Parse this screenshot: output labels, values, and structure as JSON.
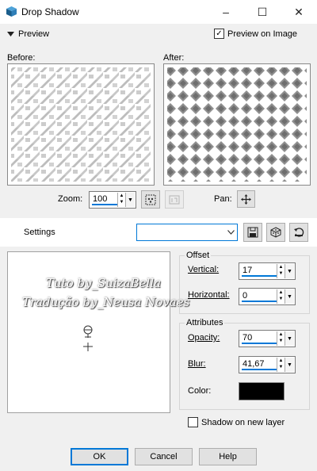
{
  "window": {
    "title": "Drop Shadow",
    "minimize_glyph": "–",
    "maximize_glyph": "☐",
    "close_glyph": "✕"
  },
  "preview": {
    "toggle_label": "Preview",
    "preview_on_image_label": "Preview on Image",
    "preview_on_image_checked": true
  },
  "panes": {
    "before_label": "Before:",
    "after_label": "After:"
  },
  "zoom": {
    "label": "Zoom:",
    "value": "100"
  },
  "pan": {
    "label": "Pan:"
  },
  "settings": {
    "label": "Settings",
    "preset_value": ""
  },
  "watermark": {
    "line1": "Tuto by_SuizaBella",
    "line2": "Tradução by_Neusa Novaes"
  },
  "offset": {
    "group_label": "Offset",
    "vertical_label": "Vertical:",
    "vertical_value": "17",
    "horizontal_label": "Horizontal:",
    "horizontal_value": "0"
  },
  "attributes": {
    "group_label": "Attributes",
    "opacity_label": "Opacity:",
    "opacity_value": "70",
    "blur_label": "Blur:",
    "blur_value": "41,67",
    "color_label": "Color:",
    "color_hex": "#000000"
  },
  "shadow_on_new_layer": {
    "label": "Shadow on new layer",
    "checked": false
  },
  "buttons": {
    "ok": "OK",
    "cancel": "Cancel",
    "help": "Help"
  },
  "colors": {
    "accent": "#0078d7",
    "window_bg": "#f0f0f0",
    "titlebar_bg": "#ffffff"
  }
}
